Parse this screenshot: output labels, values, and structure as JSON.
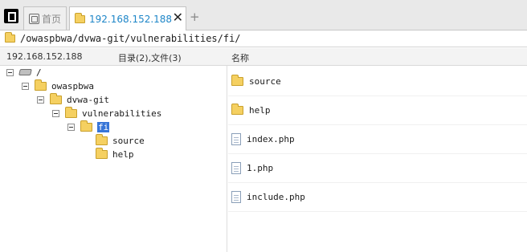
{
  "tabs": [
    {
      "label": "首页",
      "icon": "home-icon"
    },
    {
      "label": "192.168.152.188",
      "icon": "folder-icon",
      "active": true
    }
  ],
  "new_tab_label": "+",
  "close_label": "✕",
  "address": {
    "path": "/owaspbwa/dvwa-git/vulnerabilities/fi/"
  },
  "header": {
    "host": "192.168.152.188",
    "summary": "目录(2),文件(3)",
    "column_name": "名称"
  },
  "tree": [
    {
      "label": "/",
      "icon": "drive-icon",
      "depth": 0
    },
    {
      "label": "owaspbwa",
      "icon": "folder-icon",
      "depth": 1
    },
    {
      "label": "dvwa-git",
      "icon": "folder-icon",
      "depth": 2
    },
    {
      "label": "vulnerabilities",
      "icon": "folder-icon",
      "depth": 3
    },
    {
      "label": "fi",
      "icon": "folder-open-icon",
      "depth": 4,
      "selected": true
    },
    {
      "label": "source",
      "icon": "folder-icon",
      "depth": 5
    },
    {
      "label": "help",
      "icon": "folder-icon",
      "depth": 5
    }
  ],
  "files": [
    {
      "name": "source",
      "type": "folder"
    },
    {
      "name": "help",
      "type": "folder"
    },
    {
      "name": "index.php",
      "type": "file"
    },
    {
      "name": "1.php",
      "type": "file"
    },
    {
      "name": "include.php",
      "type": "file"
    }
  ],
  "colors": {
    "accent": "#1e86c8",
    "selection": "#3875d7",
    "folder": "#f5d061"
  }
}
